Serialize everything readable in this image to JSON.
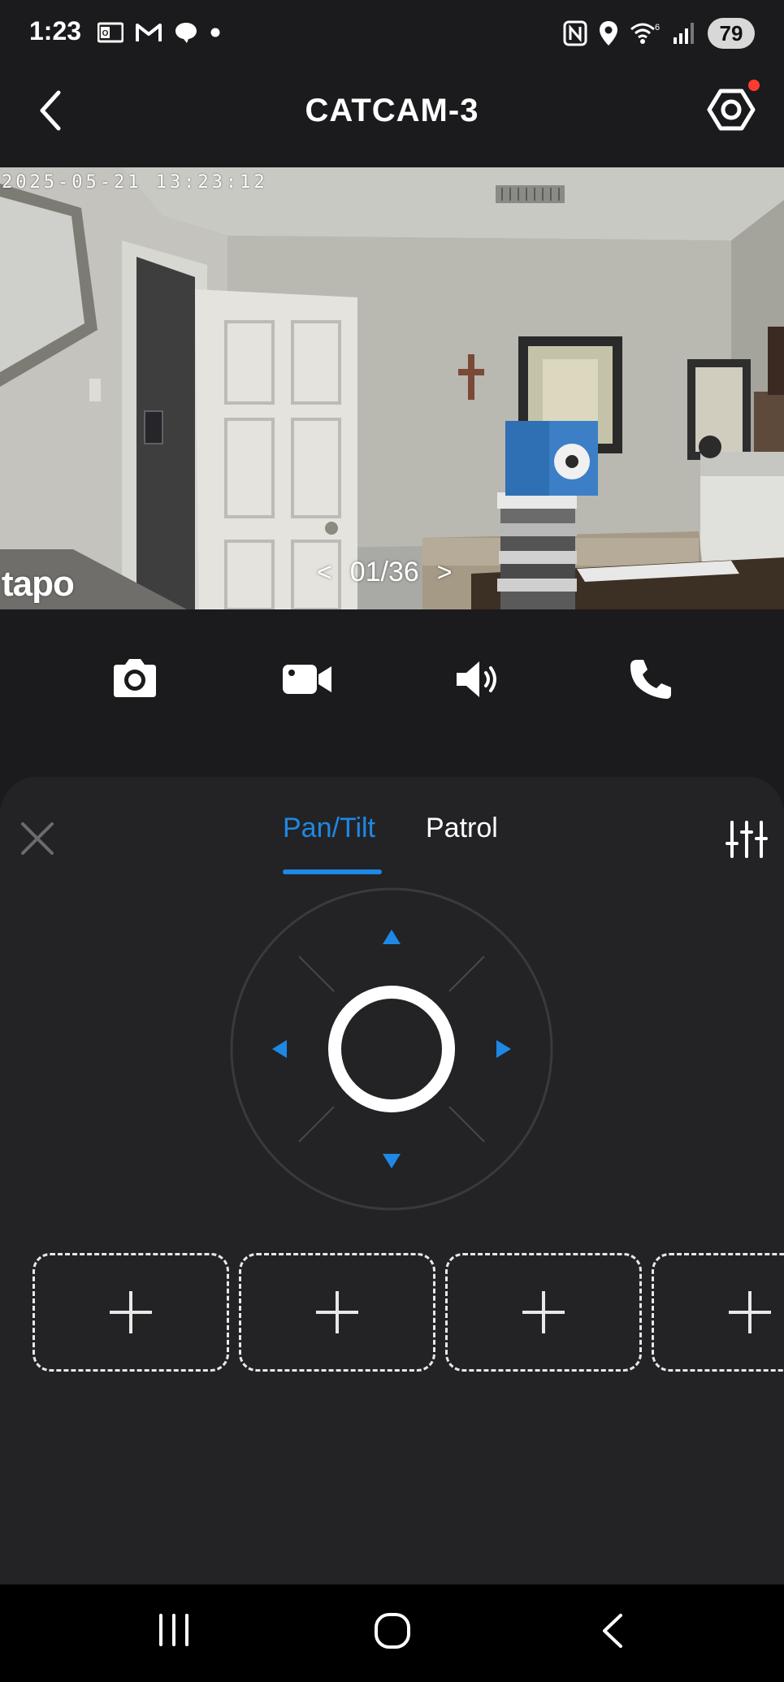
{
  "status_bar": {
    "time": "1:23",
    "battery": "79",
    "left_icons": [
      "outlook-icon",
      "gmail-icon",
      "chat-icon",
      "dot-icon"
    ],
    "right_icons": [
      "nfc-icon",
      "location-icon",
      "wifi-6-icon",
      "signal-icon"
    ]
  },
  "header": {
    "title": "CATCAM-3",
    "has_notification_dot": true
  },
  "video": {
    "timestamp": "2025-05-21  13:23:12",
    "logo": "tapo",
    "page_prev": "<",
    "page_indicator": "01/36",
    "page_next": ">"
  },
  "controls": [
    {
      "name": "snapshot",
      "icon": "camera-icon"
    },
    {
      "name": "record",
      "icon": "video-camera-icon"
    },
    {
      "name": "speaker",
      "icon": "speaker-icon"
    },
    {
      "name": "call",
      "icon": "phone-icon"
    }
  ],
  "panel": {
    "tabs": [
      {
        "label": "Pan/Tilt",
        "active": true
      },
      {
        "label": "Patrol",
        "active": false
      }
    ],
    "accent_color": "#1e88e5",
    "presets": [
      {
        "icon": "plus-icon"
      },
      {
        "icon": "plus-icon"
      },
      {
        "icon": "plus-icon"
      },
      {
        "icon": "plus-icon"
      }
    ]
  },
  "system_nav": [
    "recents-icon",
    "home-icon",
    "back-icon"
  ]
}
